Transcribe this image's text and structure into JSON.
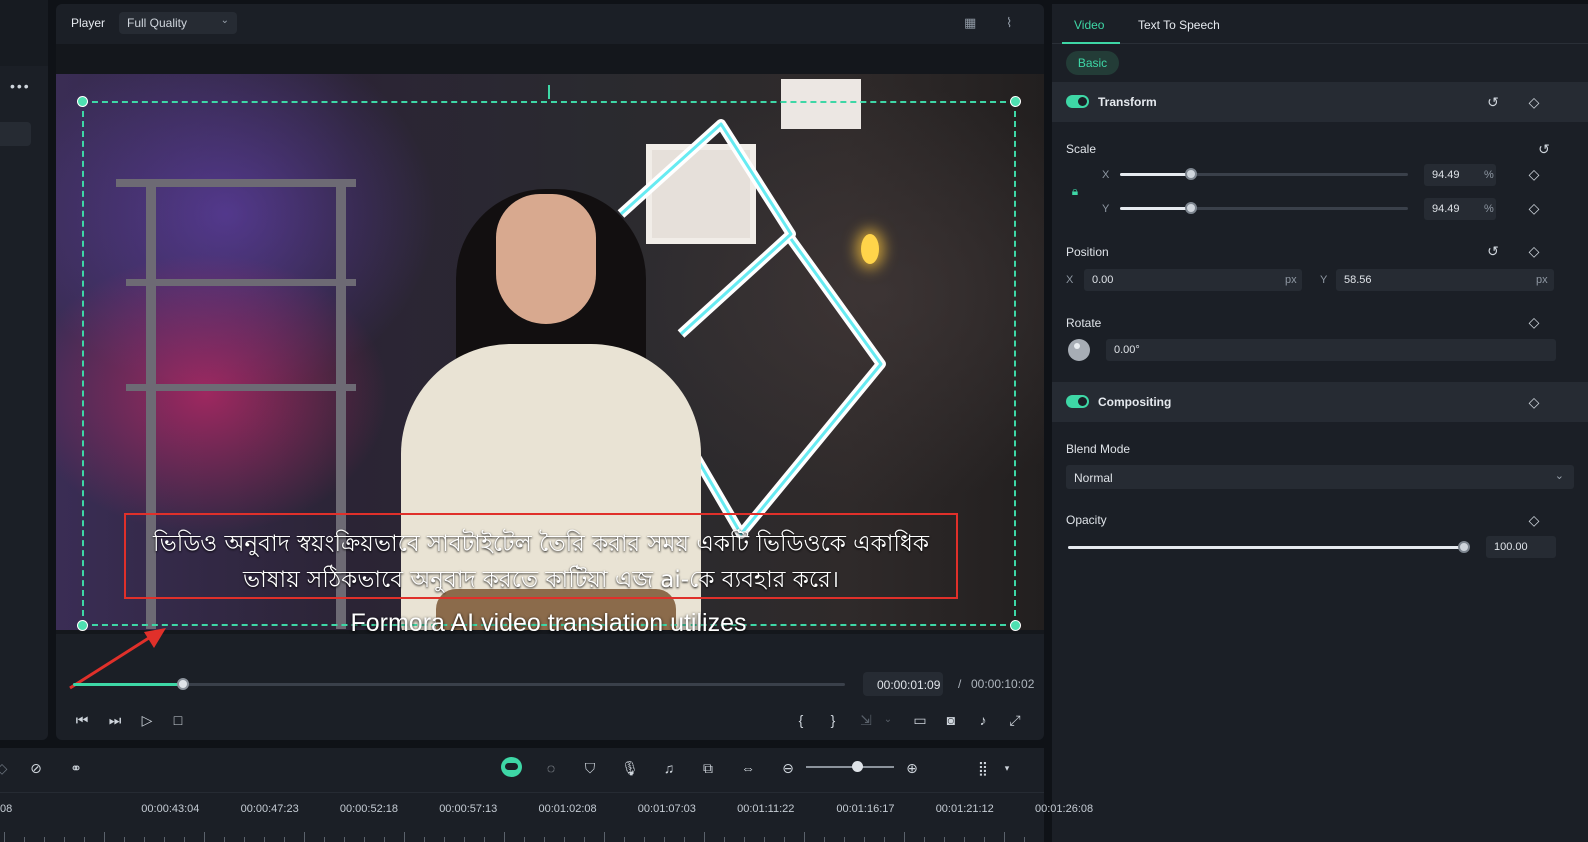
{
  "player": {
    "label": "Player",
    "quality": "Full Quality",
    "current_time": "00:00:01:09",
    "separator": "/",
    "duration": "00:00:10:02",
    "progress_fraction": 0.142
  },
  "video": {
    "bengali_line1": "ভিডিও অনুবাদ স্বয়ংক্রিয়ভাবে সাবটাইটেল তৈরি করার সময় একটি ভিডিওকে একাধিক",
    "bengali_line2": "ভাষায় সঠিকভাবে অনুবাদ করতে কাটিয়া এজ ai-কে ব্যবহার করে।",
    "caption": "Formora AI video translation utilizes"
  },
  "properties": {
    "tabs": [
      "Video",
      "Text To Speech"
    ],
    "active_tab": "Video",
    "chip": "Basic",
    "transform": {
      "title": "Transform",
      "scale_label": "Scale",
      "scale_x": "94.49",
      "scale_y": "94.49",
      "scale_unit": "%",
      "scale_fraction": 0.245,
      "axis_x": "X",
      "axis_y": "Y",
      "position_label": "Position",
      "pos_x": "0.00",
      "pos_y": "58.56",
      "pos_unit": "px",
      "rotate_label": "Rotate",
      "rotate_value": "0.00°"
    },
    "compositing": {
      "title": "Compositing",
      "blend_label": "Blend Mode",
      "blend_value": "Normal",
      "opacity_label": "Opacity",
      "opacity_value": "100.00",
      "opacity_fraction": 1.0
    }
  },
  "timeline": {
    "ruler_labels": [
      "08",
      "00:00:43:04",
      "00:00:47:23",
      "00:00:52:18",
      "00:00:57:13",
      "00:01:02:08",
      "00:01:07:03",
      "00:01:11:22",
      "00:01:16:17",
      "00:01:21:12",
      "00:01:26:08"
    ]
  },
  "colors": {
    "accent": "#3ed7a6",
    "highlight_box": "#e0302a",
    "panel": "#1b1f26",
    "background": "#0f1217"
  }
}
